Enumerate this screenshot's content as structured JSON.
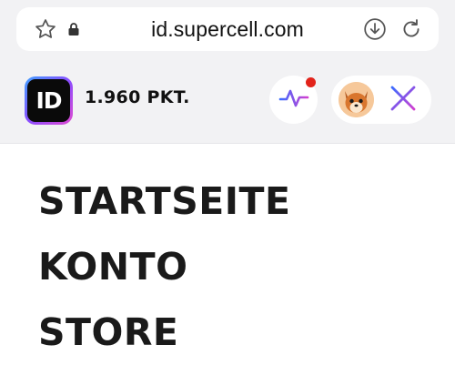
{
  "browser": {
    "url": "id.supercell.com",
    "icons": [
      "star-icon",
      "lock-icon",
      "download-icon",
      "reload-icon"
    ]
  },
  "header": {
    "logo_text": "ID",
    "points": "1.960 PKT.",
    "has_notification": true,
    "icons": [
      "activity-icon",
      "avatar",
      "close-icon"
    ]
  },
  "menu": {
    "items": [
      "STARTSEITE",
      "KONTO",
      "STORE"
    ]
  },
  "colors": {
    "accent_gradient_start": "#3fa0ff",
    "accent_gradient_end": "#e04ad0",
    "notification": "#e2231a"
  }
}
